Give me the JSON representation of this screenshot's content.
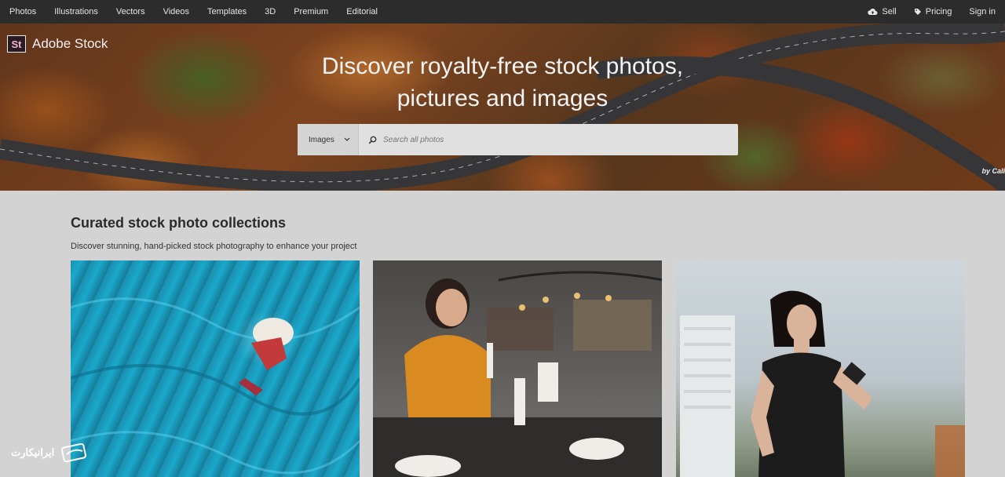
{
  "nav": {
    "left": [
      "Photos",
      "Illustrations",
      "Vectors",
      "Videos",
      "Templates",
      "3D",
      "Premium",
      "Editorial"
    ],
    "sell": "Sell",
    "pricing": "Pricing",
    "signin": "Sign in"
  },
  "brand": {
    "badge": "St",
    "name": "Adobe Stock"
  },
  "hero": {
    "headline": "Discover royalty-free stock photos, pictures and images",
    "credit": "by Cali"
  },
  "search": {
    "category": "Images",
    "placeholder": "Search all photos"
  },
  "collections": {
    "title": "Curated stock photo collections",
    "subtitle": "Discover stunning, hand-picked stock photography to enhance your project"
  },
  "watermark": {
    "text": "ایرانیکارت"
  },
  "colors": {
    "nav_bg": "#2c2c2c",
    "page_bg": "#d3d3d3",
    "brand_accent": "#f2b6d4"
  }
}
